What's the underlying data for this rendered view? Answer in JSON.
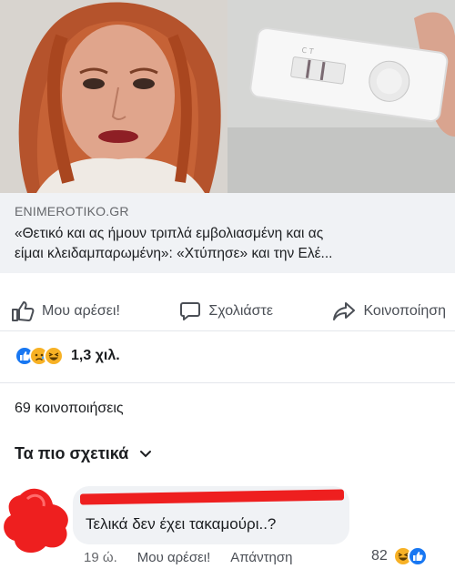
{
  "link_preview": {
    "domain": "ENIMEROTIKO.GR",
    "title_line1": "«Θετικό και ας ήμουν τριπλά εμβολιασμένη και ας",
    "title_line2": "είμαι κλειδαμπαρωμένη»: «Χτύπησε» και την Ελέ..."
  },
  "actions": {
    "like": "Μου αρέσει!",
    "comment": "Σχολιάστε",
    "share": "Κοινοποίηση"
  },
  "reactions": {
    "icons": [
      "like-icon",
      "sad-icon",
      "haha-icon"
    ],
    "count": "1,3 χιλ."
  },
  "shares_text": "69 κοινοποιήσεις",
  "sort_label": "Τα πιο σχετικά",
  "comment": {
    "text": "Τελικά δεν έχει τακαμούρι..?",
    "time": "19 ώ.",
    "like": "Μου αρέσει!",
    "reply": "Απάντηση",
    "reaction_count": "82",
    "reaction_icons": [
      "haha-icon",
      "like-icon"
    ]
  },
  "colors": {
    "accent_blue": "#1877f2",
    "redaction": "#ee1f1f",
    "bubble": "#f0f2f5",
    "reaction_yellow": "#f7b125"
  }
}
